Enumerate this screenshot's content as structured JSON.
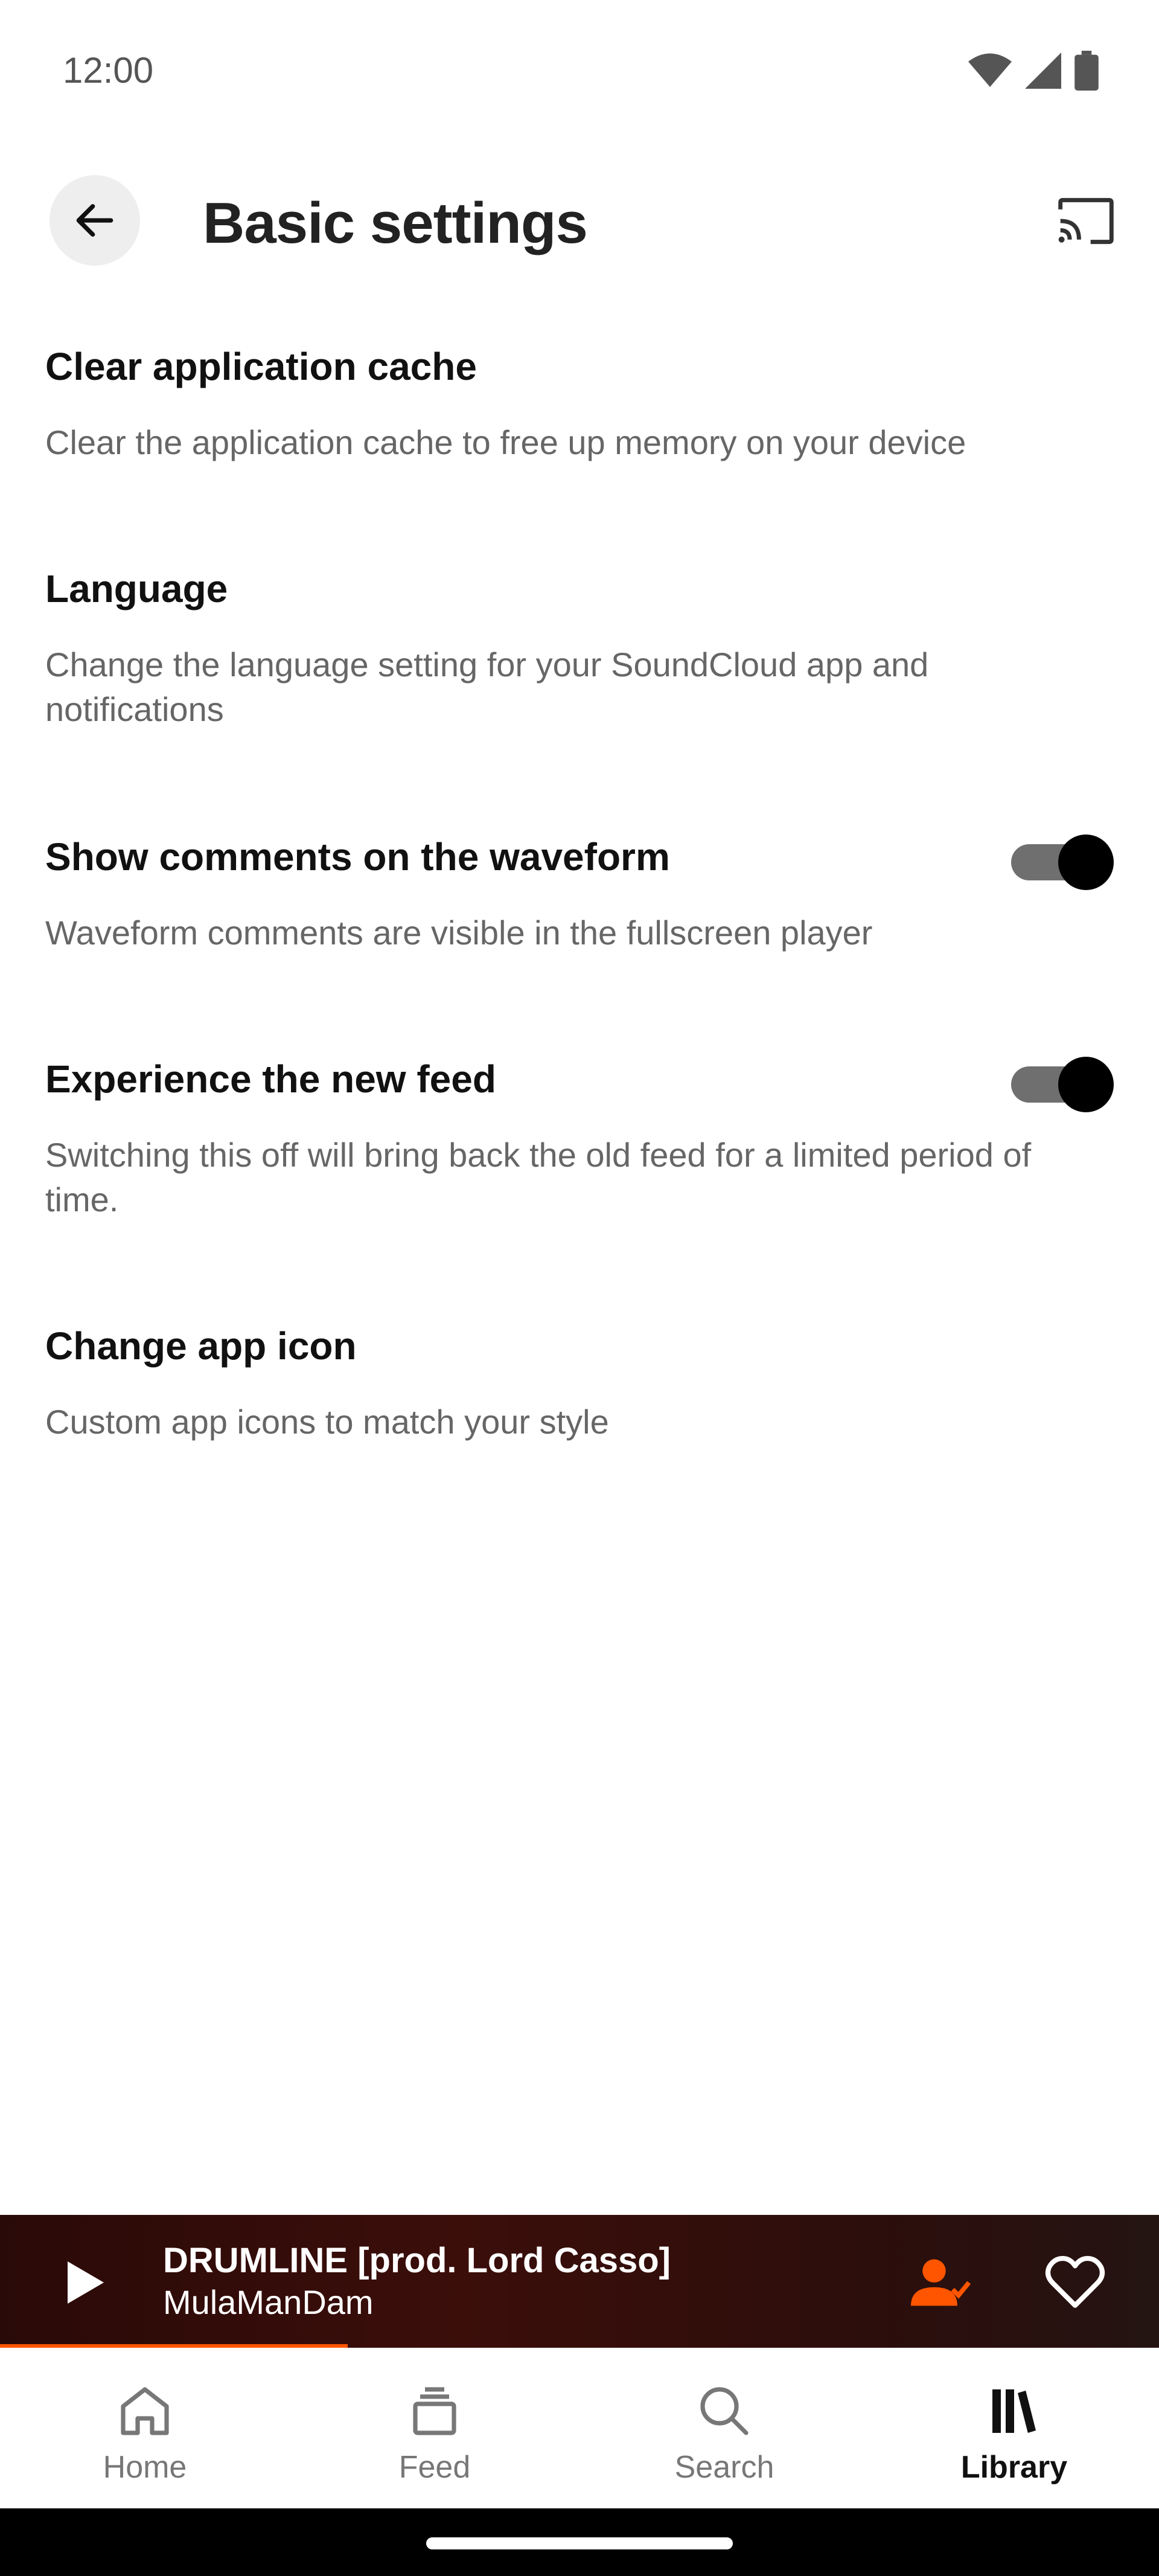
{
  "status_bar": {
    "time": "12:00",
    "icons": [
      "wifi-icon",
      "cellular-signal-icon",
      "battery-icon"
    ]
  },
  "app_bar": {
    "title": "Basic settings",
    "back_icon": "arrow-left-icon",
    "cast_icon": "cast-icon"
  },
  "settings": [
    {
      "title": "Clear application cache",
      "description": "Clear the application cache to free up memory on your device",
      "toggle": null
    },
    {
      "title": "Language",
      "description": "Change the language setting for your SoundCloud app and notifications",
      "toggle": null
    },
    {
      "title": "Show comments on the waveform",
      "description": "Waveform comments are visible in the fullscreen player",
      "toggle": true
    },
    {
      "title": "Experience the new feed",
      "description": "Switching this off will bring back the old feed for a limited period of time.",
      "toggle": true
    },
    {
      "title": "Change app icon",
      "description": "Custom app icons to match your style",
      "toggle": null
    }
  ],
  "mini_player": {
    "track_title": "DRUMLINE [prod. Lord Casso]",
    "artist": "MulaManDam",
    "progress": 0.3,
    "accent_color": "#ff5500"
  },
  "bottom_nav": {
    "items": [
      {
        "label": "Home",
        "icon": "home-icon",
        "active": false
      },
      {
        "label": "Feed",
        "icon": "feed-stack-icon",
        "active": false
      },
      {
        "label": "Search",
        "icon": "search-icon",
        "active": false
      },
      {
        "label": "Library",
        "icon": "library-icon",
        "active": true
      }
    ]
  }
}
